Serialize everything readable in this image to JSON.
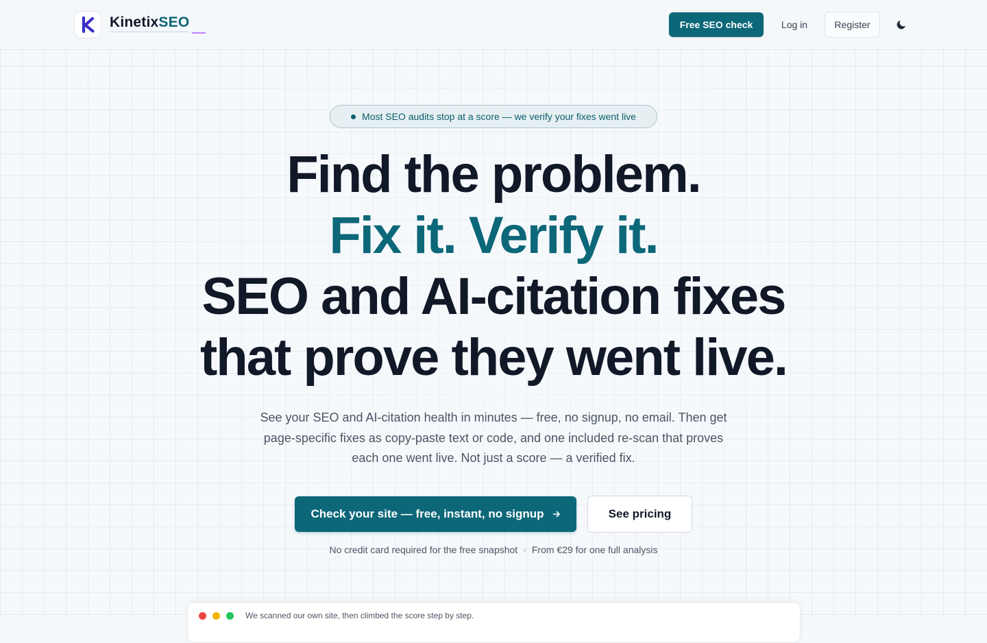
{
  "header": {
    "logo": {
      "name_part1": "Kinetix",
      "name_part2": "SEO"
    },
    "nav": {
      "free_check_label": "Free SEO check",
      "login_label": "Log in",
      "register_label": "Register"
    },
    "theme_toggle_icon": "moon-icon"
  },
  "hero": {
    "badge_text": "Most SEO audits stop at a score — we verify your fixes went live",
    "headline": {
      "line1": "Find the problem.",
      "line2": "Fix it. Verify it.",
      "line3": "SEO and AI-citation fixes",
      "line4": "that prove they went live."
    },
    "subtext": "See your SEO and AI-citation health in minutes — free, no signup, no email. Then get page-specific fixes as copy-paste text or code, and one included re-scan that proves each one went live. Not just a score — a verified fix.",
    "cta_primary_label": "Check your site — free, instant, no signup",
    "cta_secondary_label": "See pricing",
    "footnote": {
      "left": "No credit card required for the free snapshot",
      "separator": "·",
      "right": "From €29 for one full analysis"
    }
  },
  "preview": {
    "caption": "We scanned our own site, then climbed the score step by step."
  },
  "colors": {
    "brand": "#0c6779",
    "logo_k": "#3b2fc9",
    "text_dark": "#111827",
    "text_muted": "#4b5563",
    "traffic_red": "#ef4444",
    "traffic_yellow": "#f5b300",
    "traffic_green": "#22c55e"
  }
}
